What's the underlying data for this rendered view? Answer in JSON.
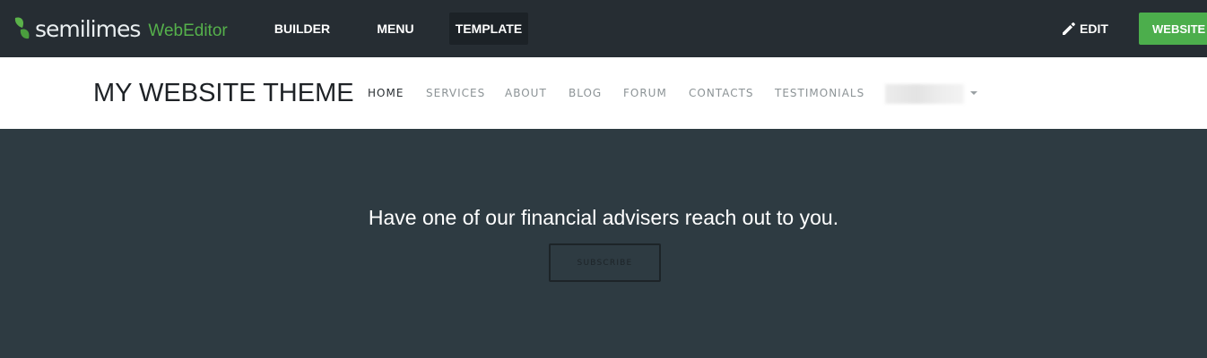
{
  "editor": {
    "brand": "semilimes",
    "brand_sub": "WebEditor",
    "nav": [
      {
        "label": "BUILDER",
        "active": false
      },
      {
        "label": "MENU",
        "active": false
      },
      {
        "label": "TEMPLATE",
        "active": true
      }
    ],
    "edit_label": "EDIT",
    "website_label": "WEBSITE",
    "colors": {
      "topbar_bg": "#262d33",
      "accent_green": "#4cae4c",
      "brand_green": "#55b04b"
    }
  },
  "site": {
    "title": "MY WEBSITE THEME",
    "nav": [
      {
        "label": "HOME",
        "active": true
      },
      {
        "label": "SERVICES"
      },
      {
        "label": "ABOUT"
      },
      {
        "label": "BLOG"
      },
      {
        "label": "FORUM"
      },
      {
        "label": "CONTACTS"
      },
      {
        "label": "TESTIMONIALS"
      }
    ],
    "dropdown_icon": "caret-down-icon"
  },
  "hero": {
    "headline": "Have one of our financial advisers reach out to you.",
    "button_label": "SUBSCRIBE",
    "background": "#2e3b42"
  }
}
